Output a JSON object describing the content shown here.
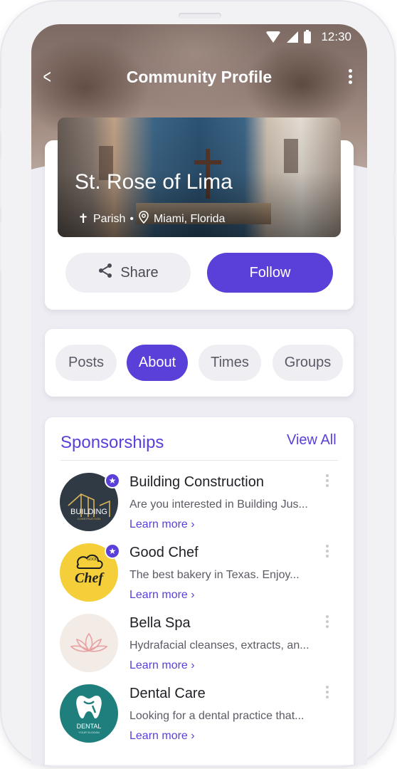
{
  "status": {
    "time": "12:30"
  },
  "appbar": {
    "title": "Community Profile"
  },
  "profile": {
    "name": "St. Rose of Lima",
    "type": "Parish",
    "separator": "•",
    "location": "Miami, Florida",
    "share_label": "Share",
    "follow_label": "Follow"
  },
  "tabs": [
    {
      "label": "Posts"
    },
    {
      "label": "About"
    },
    {
      "label": "Times"
    },
    {
      "label": "Groups"
    }
  ],
  "sponsorships": {
    "title": "Sponsorships",
    "view_all": "View All",
    "items": [
      {
        "name": "Building Construction",
        "desc": "Are you interested in Building Jus...",
        "link": "Learn more",
        "featured": true,
        "logo_text": "BUILDING",
        "logo_sub": "CONSTRUCTION"
      },
      {
        "name": "Good Chef",
        "desc": "The best bakery in Texas. Enjoy...",
        "link": "Learn more",
        "featured": true,
        "logo_text": "Chef",
        "logo_sub": "GOOD"
      },
      {
        "name": "Bella Spa",
        "desc": "Hydrafacial cleanses, extracts, an...",
        "link": "Learn more",
        "featured": false
      },
      {
        "name": "Dental Care",
        "desc": "Looking for a dental practice that...",
        "link": "Learn more",
        "featured": false,
        "logo_text": "DENTAL",
        "logo_sub": "YOUR SLOGAN"
      }
    ]
  },
  "colors": {
    "accent": "#5a3fd8",
    "background": "#eeedf3"
  },
  "icons": {
    "back": "back-arrow-icon",
    "more": "more-vertical-icon",
    "share": "share-icon",
    "cross": "cross-icon",
    "location": "location-pin-icon",
    "star": "star-badge-icon"
  }
}
